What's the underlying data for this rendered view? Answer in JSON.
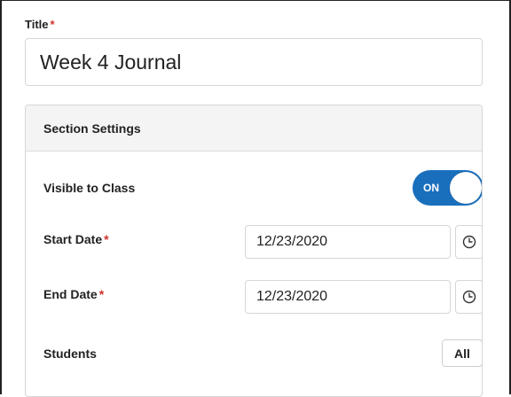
{
  "title_field": {
    "label": "Title",
    "required_mark": "*",
    "value": "Week 4 Journal"
  },
  "section": {
    "header": "Section Settings",
    "visible_to_class": {
      "label": "Visible to Class",
      "toggle_text": "ON",
      "state": "on",
      "color": "#1a6fbd"
    },
    "start_date": {
      "label": "Start Date",
      "required_mark": "*",
      "value": "12/23/2020",
      "icon": "clock-icon"
    },
    "end_date": {
      "label": "End Date",
      "required_mark": "*",
      "value": "12/23/2020",
      "icon": "clock-icon"
    },
    "students": {
      "label": "Students",
      "button_label": "All"
    }
  },
  "colors": {
    "required": "#d0312d",
    "accent": "#1a6fbd"
  }
}
